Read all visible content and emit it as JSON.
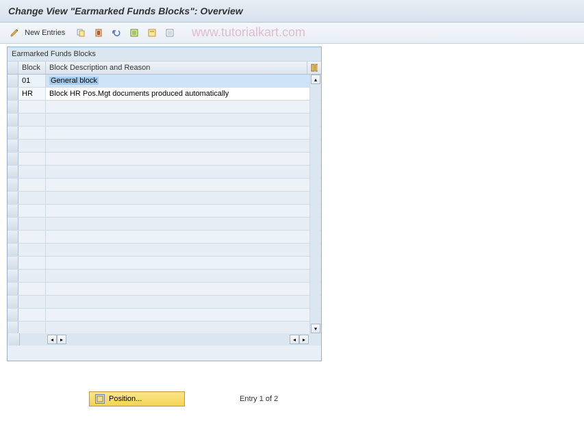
{
  "title": "Change View \"Earmarked Funds Blocks\": Overview",
  "toolbar": {
    "new_entries": "New Entries"
  },
  "watermark": "www.tutorialkart.com",
  "panel": {
    "title": "Earmarked Funds Blocks",
    "columns": {
      "block": "Block",
      "desc": "Block Description and Reason"
    }
  },
  "rows": [
    {
      "block": "01",
      "desc": "General block"
    },
    {
      "block": "HR",
      "desc": "Block HR Pos.Mgt documents produced automatically"
    }
  ],
  "footer": {
    "position_label": "Position...",
    "entry_text": "Entry 1 of 2"
  }
}
